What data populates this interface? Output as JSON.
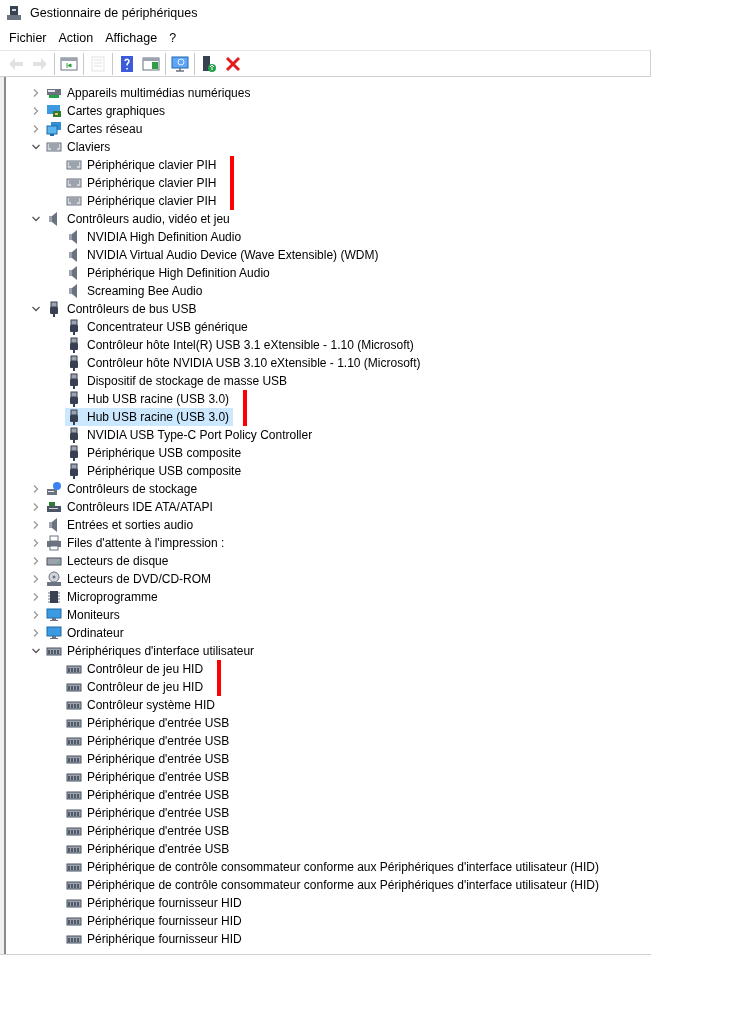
{
  "window": {
    "title": "Gestionnaire de périphériques"
  },
  "menu": [
    {
      "label": "Fichier"
    },
    {
      "label": "Action"
    },
    {
      "label": "Affichage"
    },
    {
      "label": "?"
    }
  ],
  "toolbar": [
    [
      {
        "kind": "back",
        "disabled": true
      },
      {
        "kind": "forward",
        "disabled": true
      }
    ],
    [
      {
        "kind": "tree",
        "disabled": false
      }
    ],
    [
      {
        "kind": "properties",
        "disabled": true
      }
    ],
    [
      {
        "kind": "help",
        "disabled": false
      },
      {
        "kind": "pane",
        "disabled": false
      }
    ],
    [
      {
        "kind": "scan",
        "disabled": false
      }
    ],
    [
      {
        "kind": "update",
        "disabled": false
      },
      {
        "kind": "remove",
        "disabled": false
      }
    ]
  ],
  "tree": [
    {
      "label": "Appareils multimédias numériques",
      "kind": "multimedia",
      "expanded": false
    },
    {
      "label": "Cartes graphiques",
      "kind": "display",
      "expanded": false
    },
    {
      "label": "Cartes réseau",
      "kind": "network",
      "expanded": false
    },
    {
      "label": "Claviers",
      "kind": "keyboard",
      "expanded": true,
      "children": [
        {
          "label": "Périphérique clavier PIH",
          "kind": "keyboard",
          "selected": false,
          "marked": true
        },
        {
          "label": "Périphérique clavier PIH",
          "kind": "keyboard",
          "selected": false,
          "marked": true
        },
        {
          "label": "Périphérique clavier PIH",
          "kind": "keyboard",
          "selected": false,
          "marked": true
        }
      ]
    },
    {
      "label": "Contrôleurs audio, vidéo et jeu",
      "kind": "speaker",
      "expanded": true,
      "children": [
        {
          "label": "NVIDIA High Definition Audio",
          "kind": "speaker",
          "selected": false,
          "marked": false
        },
        {
          "label": "NVIDIA Virtual Audio Device (Wave Extensible) (WDM)",
          "kind": "speaker",
          "selected": false,
          "marked": false
        },
        {
          "label": "Périphérique High Definition Audio",
          "kind": "speaker",
          "selected": false,
          "marked": false
        },
        {
          "label": "Screaming Bee Audio",
          "kind": "speaker",
          "selected": false,
          "marked": false
        }
      ]
    },
    {
      "label": "Contrôleurs de bus USB",
      "kind": "usb",
      "expanded": true,
      "children": [
        {
          "label": "Concentrateur USB générique",
          "kind": "usb",
          "selected": false,
          "marked": false
        },
        {
          "label": "Contrôleur hôte Intel(R) USB 3.1 eXtensible - 1.10 (Microsoft)",
          "kind": "usb",
          "selected": false,
          "marked": false
        },
        {
          "label": "Contrôleur hôte NVIDIA USB 3.10 eXtensible - 1.10 (Microsoft)",
          "kind": "usb",
          "selected": false,
          "marked": false
        },
        {
          "label": "Dispositif de stockage de masse USB",
          "kind": "usb",
          "selected": false,
          "marked": false
        },
        {
          "label": "Hub USB racine (USB 3.0)",
          "kind": "usb",
          "selected": false,
          "marked": true
        },
        {
          "label": "Hub USB racine (USB 3.0)",
          "kind": "usb",
          "selected": true,
          "marked": true
        },
        {
          "label": "NVIDIA USB Type-C Port Policy Controller",
          "kind": "usb",
          "selected": false,
          "marked": false
        },
        {
          "label": "Périphérique USB composite",
          "kind": "usb",
          "selected": false,
          "marked": false
        },
        {
          "label": "Périphérique USB composite",
          "kind": "usb",
          "selected": false,
          "marked": false
        }
      ]
    },
    {
      "label": "Contrôleurs de stockage",
      "kind": "storage",
      "expanded": false
    },
    {
      "label": "Contrôleurs IDE ATA/ATAPI",
      "kind": "ide",
      "expanded": false
    },
    {
      "label": "Entrées et sorties audio",
      "kind": "speaker",
      "expanded": false
    },
    {
      "label": "Files d'attente à l'impression :",
      "kind": "printer",
      "expanded": false
    },
    {
      "label": "Lecteurs de disque",
      "kind": "disk",
      "expanded": false
    },
    {
      "label": "Lecteurs de DVD/CD-ROM",
      "kind": "dvd",
      "expanded": false
    },
    {
      "label": "Microprogramme",
      "kind": "firmware",
      "expanded": false
    },
    {
      "label": "Moniteurs",
      "kind": "monitor",
      "expanded": false
    },
    {
      "label": "Ordinateur",
      "kind": "monitor",
      "expanded": false
    },
    {
      "label": "Périphériques d'interface utilisateur",
      "kind": "hid",
      "expanded": true,
      "children": [
        {
          "label": "Contrôleur de jeu HID",
          "kind": "hid",
          "selected": false,
          "marked": true
        },
        {
          "label": "Contrôleur de jeu HID",
          "kind": "hid",
          "selected": false,
          "marked": true
        },
        {
          "label": "Contrôleur système HID",
          "kind": "hid",
          "selected": false,
          "marked": false
        },
        {
          "label": "Périphérique d'entrée USB",
          "kind": "hid",
          "selected": false,
          "marked": false
        },
        {
          "label": "Périphérique d'entrée USB",
          "kind": "hid",
          "selected": false,
          "marked": false
        },
        {
          "label": "Périphérique d'entrée USB",
          "kind": "hid",
          "selected": false,
          "marked": false
        },
        {
          "label": "Périphérique d'entrée USB",
          "kind": "hid",
          "selected": false,
          "marked": false
        },
        {
          "label": "Périphérique d'entrée USB",
          "kind": "hid",
          "selected": false,
          "marked": false
        },
        {
          "label": "Périphérique d'entrée USB",
          "kind": "hid",
          "selected": false,
          "marked": false
        },
        {
          "label": "Périphérique d'entrée USB",
          "kind": "hid",
          "selected": false,
          "marked": false
        },
        {
          "label": "Périphérique d'entrée USB",
          "kind": "hid",
          "selected": false,
          "marked": false
        },
        {
          "label": "Périphérique de contrôle consommateur conforme aux Périphériques d'interface utilisateur (HID)",
          "kind": "hid",
          "selected": false,
          "marked": false
        },
        {
          "label": "Périphérique de contrôle consommateur conforme aux Périphériques d'interface utilisateur (HID)",
          "kind": "hid",
          "selected": false,
          "marked": false
        },
        {
          "label": "Périphérique fournisseur HID",
          "kind": "hid",
          "selected": false,
          "marked": false
        },
        {
          "label": "Périphérique fournisseur HID",
          "kind": "hid",
          "selected": false,
          "marked": false
        },
        {
          "label": "Périphérique fournisseur HID",
          "kind": "hid",
          "selected": false,
          "marked": false
        }
      ]
    }
  ]
}
